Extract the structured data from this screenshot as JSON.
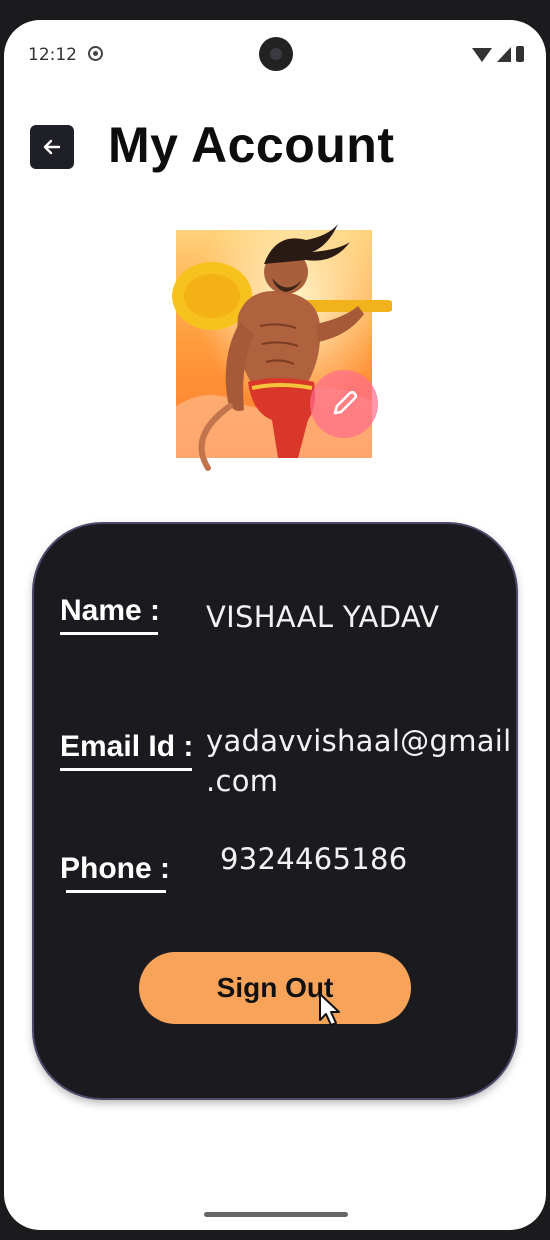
{
  "status_bar": {
    "time": "12:12"
  },
  "header": {
    "title": "My Account"
  },
  "profile": {
    "name_label": "Name :",
    "name_value": "VISHAAL YADAV",
    "email_label": "Email Id :",
    "email_value_line1": "yadavvishaal@gmail",
    "email_value_line2": ".com",
    "phone_label": "Phone :",
    "phone_value": "9324465186"
  },
  "actions": {
    "sign_out_label": "Sign Out"
  },
  "colors": {
    "card_background": "#1b1a1f",
    "sign_out_button": "#f7a45a",
    "edit_button": "#ff6e8c",
    "back_button": "#1f1f27"
  },
  "icons": {
    "back": "arrow-left-icon",
    "edit": "pencil-icon",
    "status_app": "app-notification-icon",
    "wifi": "wifi-icon",
    "signal": "signal-icon",
    "battery": "battery-icon"
  }
}
